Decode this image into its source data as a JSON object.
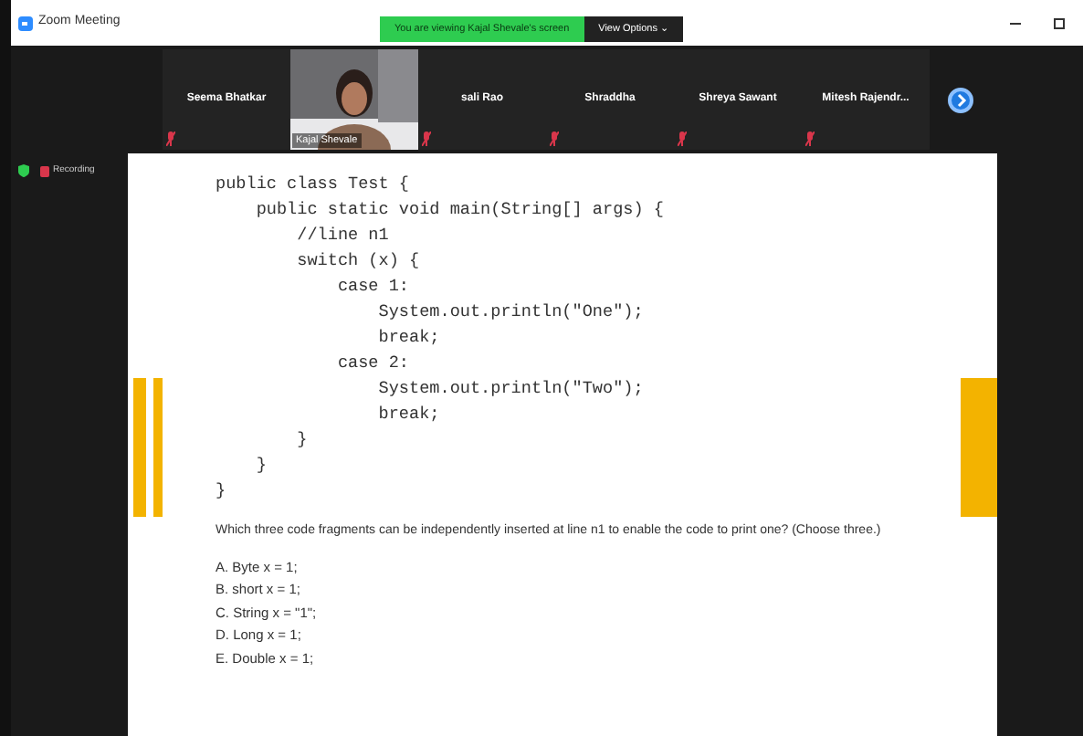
{
  "window": {
    "title": "Zoom Meeting"
  },
  "share_banner": {
    "text": "You are viewing Kajal Shevale's screen",
    "options": "View Options ⌄"
  },
  "participants": [
    {
      "kind": "name",
      "name": "Seema Bhatkar",
      "muted": true
    },
    {
      "kind": "video",
      "name": "Kajal Shevale",
      "muted": false
    },
    {
      "kind": "name",
      "name": "sali Rao",
      "muted": true
    },
    {
      "kind": "name",
      "name": "Shraddha",
      "muted": true
    },
    {
      "kind": "name",
      "name": "Shreya Sawant",
      "muted": true
    },
    {
      "kind": "name",
      "name": "Mitesh Rajendr...",
      "muted": true
    }
  ],
  "recording": {
    "label": "Recording"
  },
  "shared_screen": {
    "code": [
      "public class Test {",
      "    public static void main(String[] args) {",
      "        //line n1",
      "        switch (x) {",
      "            case 1:",
      "                System.out.println(\"One\");",
      "                break;",
      "            case 2:",
      "                System.out.println(\"Two\");",
      "                break;",
      "        }",
      "    }",
      "}"
    ],
    "question": "Which three code fragments can be independently inserted at line n1 to enable the code to print one? (Choose three.)",
    "options": [
      "A. Byte x = 1;",
      "B. short x = 1;",
      "C. String x = \"1\";",
      "D. Long x = 1;",
      "E. Double x = 1;"
    ]
  }
}
